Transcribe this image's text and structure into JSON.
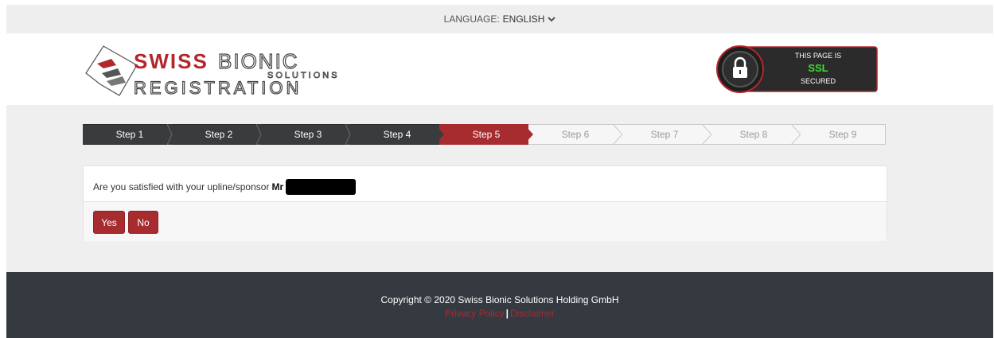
{
  "topbar": {
    "language_label": "LANGUAGE:",
    "language_value": "ENGLISH"
  },
  "header": {
    "logo": {
      "line1a": "SWISS",
      "line1b": "BIONIC",
      "line2": "SOLUTIONS",
      "line3": "REGISTRATION"
    },
    "ssl": {
      "line1": "THIS PAGE IS",
      "line2": "SSL",
      "line3": "SECURED"
    }
  },
  "steps": [
    {
      "label": "Step 1",
      "state": "done"
    },
    {
      "label": "Step 2",
      "state": "done"
    },
    {
      "label": "Step 3",
      "state": "done"
    },
    {
      "label": "Step 4",
      "state": "done"
    },
    {
      "label": "Step 5",
      "state": "active"
    },
    {
      "label": "Step 6",
      "state": "todo"
    },
    {
      "label": "Step 7",
      "state": "todo"
    },
    {
      "label": "Step 8",
      "state": "todo"
    },
    {
      "label": "Step 9",
      "state": "todo"
    }
  ],
  "question": {
    "text": "Are you satisfied with your upline/sponsor",
    "title": "Mr"
  },
  "buttons": {
    "yes": "Yes",
    "no": "No"
  },
  "footer": {
    "copyright": "Copyright © 2020 Swiss Bionic Solutions Holding GmbH",
    "privacy": "Privacy Policy",
    "separator": "|",
    "disclaimer": "Disclaimer"
  },
  "colors": {
    "accent": "#a62c30",
    "dark_step": "#3a3b3c",
    "footer_bg": "#343a40",
    "ssl_green": "#3ddc2f"
  }
}
